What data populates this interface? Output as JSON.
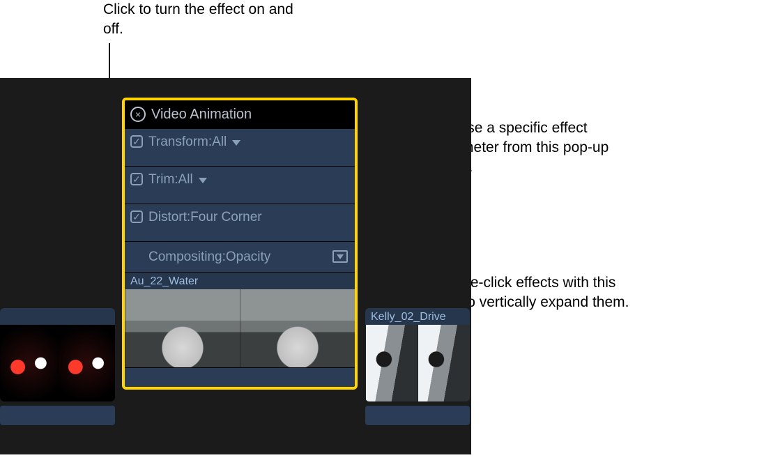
{
  "callouts": {
    "toggle_effect": "Click to turn the effect on and off.",
    "choose_param": "Choose a specific effect parameter from this pop-up menu.",
    "expand_effect": "Double-click effects with this icon to vertically expand them."
  },
  "panel": {
    "title": "Video Animation",
    "rows": [
      {
        "label": "Transform:All",
        "has_checkbox": true,
        "has_disclosure": true
      },
      {
        "label": "Trim:All",
        "has_checkbox": true,
        "has_disclosure": true
      },
      {
        "label": "Distort:Four Corner",
        "has_checkbox": true,
        "has_disclosure": false
      },
      {
        "label": "Compositing:Opacity",
        "has_checkbox": false,
        "has_disclosure": false,
        "has_expand": true
      }
    ],
    "clip_label": "Au_22_Water"
  },
  "timeline": {
    "right_clip_label": "Kelly_02_Drive"
  }
}
